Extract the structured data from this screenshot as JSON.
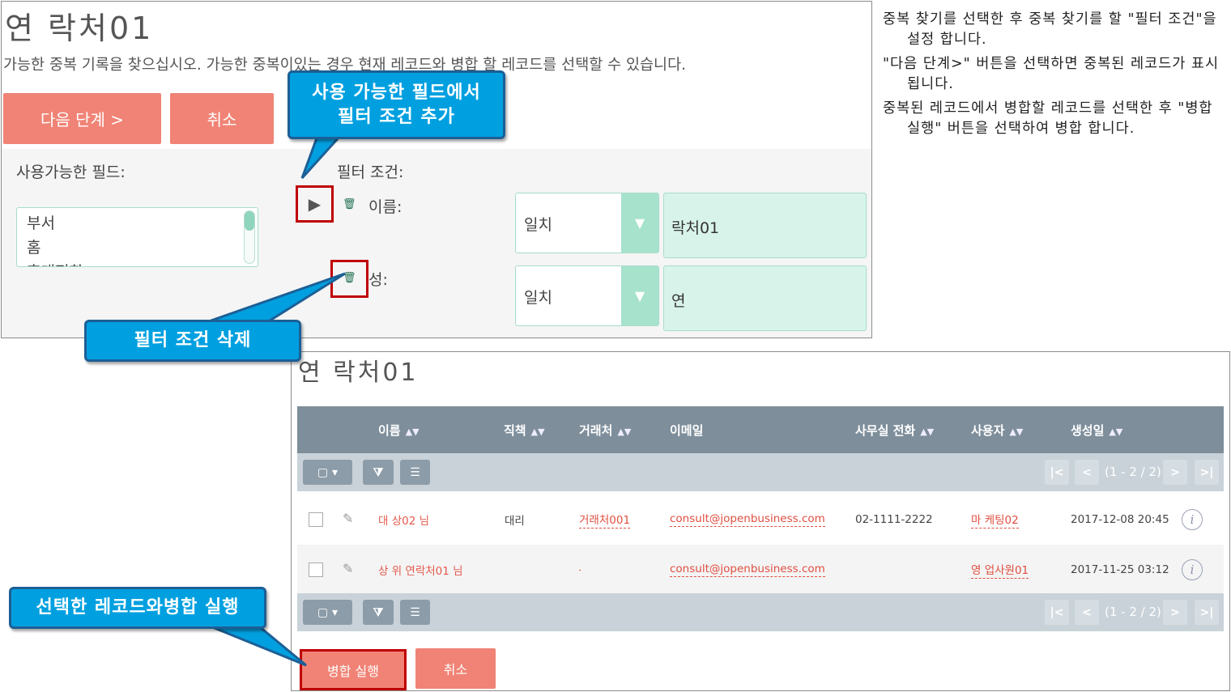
{
  "top": {
    "title": "연 락처01",
    "description": "가능한 중복 기록을 찾으십시오. 가능한 중복이있는 경우 현재 레코드와 병합 할 레코드를 선택할 수 있습니다.",
    "next_button": "다음 단계 >",
    "cancel_button": "취소",
    "available_fields_label": "사용가능한 필드:",
    "available_fields": [
      "부서",
      "홈",
      "휴대전화"
    ],
    "filter_conditions_label": "필터 조건:",
    "conditions": [
      {
        "name": "이름:",
        "match": "일치",
        "value": "락처01"
      },
      {
        "name": "성:",
        "match": "일치",
        "value": "연"
      }
    ]
  },
  "callouts": {
    "add_filter": "사용 가능한 필드에서\n필터 조건 추가",
    "delete_filter": "필터 조건 삭제",
    "merge": "선택한 레코드와병합 실행"
  },
  "notes": [
    "중복 찾기를 선택한 후 중복 찾기를 할 \"필터 조건\"을 설정 합니다.",
    "\"다음 단계>\" 버튼을 선택하면 중복된 레코드가 표시 됩니다.",
    "중복된 레코드에서 병합할 레코드를 선택한 후 \"병합 실행\" 버튼을 선택하여 병합 합니다."
  ],
  "bottom": {
    "title": "연 락처01",
    "columns": [
      "이름",
      "직책",
      "거래처",
      "이메일",
      "사무실 전화",
      "사용자",
      "생성일"
    ],
    "pagination": "(1 - 2 / 2)",
    "rows": [
      {
        "name": "대 상02 님",
        "title": "대리",
        "account": "거래처001",
        "email": "consult@jopenbusiness.com",
        "phone": "02-1111-2222",
        "user": "마 케팅02",
        "created": "2017-12-08 20:45"
      },
      {
        "name": "상 위 연락처01 님",
        "title": "",
        "account": "",
        "email": "consult@jopenbusiness.com",
        "phone": "",
        "user": "영 업사원01",
        "created": "2017-11-25 03:12"
      }
    ],
    "merge_button": "병합 실행",
    "cancel_button": "취소"
  },
  "colors": {
    "accent_button": "#f08375",
    "callout": "#00a0e0",
    "highlight_box": "#c00000",
    "table_header": "#7e8e9b",
    "field_bg": "#d8f4ea"
  }
}
